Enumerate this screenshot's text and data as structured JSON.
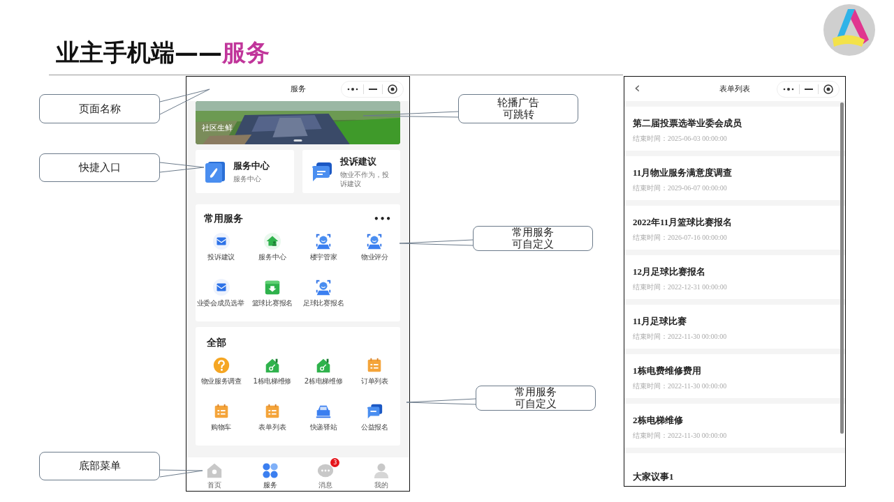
{
  "slide_title": {
    "text": "业主手机端——",
    "highlight": "服务"
  },
  "callouts": [
    {
      "lines": [
        "页面名称"
      ]
    },
    {
      "lines": [
        "快捷入口"
      ]
    },
    {
      "lines": [
        "底部菜单"
      ]
    },
    {
      "lines": [
        "轮播广告",
        "可跳转"
      ]
    },
    {
      "lines": [
        "常用服务",
        "可自定义"
      ]
    },
    {
      "lines": [
        "常用服务",
        "可自定义"
      ]
    }
  ],
  "service_screen": {
    "title": "服务",
    "banner": {
      "caption": "社区生鲜"
    },
    "quick_entries": [
      {
        "title": "服务中心",
        "subtitle": "服务中心",
        "kind": "phone"
      },
      {
        "title": "投诉建议",
        "subtitle": "物业不作为，投诉建议",
        "kind": "chat"
      }
    ],
    "common_services": {
      "title": "常用服务",
      "more": "•••",
      "items": [
        {
          "label": "投诉建议",
          "kind": "mail"
        },
        {
          "label": "服务中心",
          "kind": "house"
        },
        {
          "label": "楼宇管家",
          "kind": "face"
        },
        {
          "label": "物业评分",
          "kind": "face"
        },
        {
          "label": "业委会成员选举",
          "kind": "mail"
        },
        {
          "label": "篮球比赛报名",
          "kind": "download"
        },
        {
          "label": "足球比赛报名",
          "kind": "face"
        }
      ]
    },
    "all_services": {
      "title": "全部",
      "items": [
        {
          "label": "物业服务调查",
          "kind": "question"
        },
        {
          "label": "1栋电梯维修",
          "kind": "key"
        },
        {
          "label": "2栋电梯维修",
          "kind": "key"
        },
        {
          "label": "订单列表",
          "kind": "calendar"
        },
        {
          "label": "购物车",
          "kind": "calendar"
        },
        {
          "label": "表单列表",
          "kind": "calendar"
        },
        {
          "label": "快递驿站",
          "kind": "car"
        },
        {
          "label": "公益报名",
          "kind": "chat"
        }
      ]
    },
    "bottom_nav": [
      {
        "label": "首页",
        "kind": "home",
        "selected": false
      },
      {
        "label": "服务",
        "kind": "grid",
        "selected": true
      },
      {
        "label": "消息",
        "kind": "message",
        "selected": false,
        "badge": "3"
      },
      {
        "label": "我的",
        "kind": "person",
        "selected": false
      }
    ]
  },
  "form_list_screen": {
    "back": "‹",
    "title": "表单列表",
    "items": [
      {
        "title": "第二届投票选举业委会成员",
        "time": "结束时间：2025-06-03 00:00:00"
      },
      {
        "title": "11月物业服务满意度调查",
        "time": "结束时间：2029-06-07 00:00:00"
      },
      {
        "title": "2022年11月篮球比赛报名",
        "time": "结束时间：2026-07-16 00:00:00"
      },
      {
        "title": "12月足球比赛报名",
        "time": "结束时间：2022-12-31 00:00:00"
      },
      {
        "title": "11月足球比赛",
        "time": "结束时间：2022-11-30 00:00:00"
      },
      {
        "title": "1栋电费维修费用",
        "time": "结束时间：2022-11-30 00:00:00"
      },
      {
        "title": "2栋电梯维修",
        "time": "结束时间：2022-11-30 00:00:00"
      },
      {
        "title": "大家议事1"
      }
    ]
  }
}
